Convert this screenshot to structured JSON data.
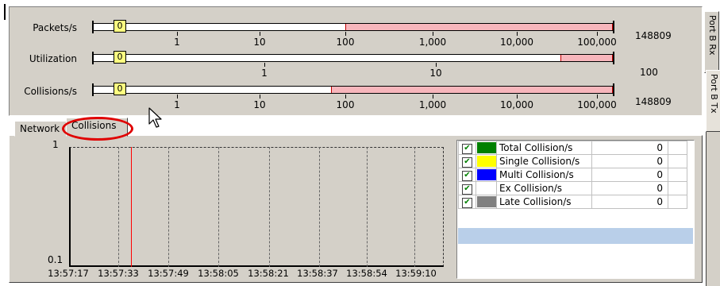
{
  "gauges": [
    {
      "label": "Packets/s",
      "value": "0",
      "total": "148809",
      "ticks": [
        "1",
        "10",
        "100",
        "1,000",
        "10,000",
        "100,000"
      ]
    },
    {
      "label": "Utilization",
      "value": "0",
      "total": "100",
      "ticks": [
        "1",
        "10"
      ]
    },
    {
      "label": "Collisions/s",
      "value": "0",
      "total": "148809",
      "ticks": [
        "1",
        "10",
        "100",
        "1,000",
        "10,000",
        "100,000"
      ]
    }
  ],
  "side_tabs": {
    "rx": "Port B Rx",
    "tx": "Port B Tx"
  },
  "tabs": {
    "network": "Network",
    "collisions": "Collisions",
    "active": "Collisions"
  },
  "graph": {
    "y_max": "1",
    "y_min": "0.1",
    "x_labels": [
      "13:57:17",
      "13:57:33",
      "13:57:49",
      "13:58:05",
      "13:58:21",
      "13:58:37",
      "13:58:54",
      "13:59:10"
    ],
    "cursor_color": "#ff0000"
  },
  "legend": {
    "rows": [
      {
        "checked": true,
        "color": "#008000",
        "name": "Total Collision/s",
        "value": "0"
      },
      {
        "checked": true,
        "color": "#ffff00",
        "name": "Single Collision/s",
        "value": "0"
      },
      {
        "checked": true,
        "color": "#0000ff",
        "name": "Multi Collision/s",
        "value": "0"
      },
      {
        "checked": true,
        "color": "#ffffff",
        "name": "Ex Collision/s",
        "value": "0"
      },
      {
        "checked": true,
        "color": "#808080",
        "name": "Late Collision/s",
        "value": "0"
      }
    ],
    "selected_row_color": "#b9cfe9"
  },
  "colors": {
    "panel": "#d4d0c8",
    "highlight_ellipse": "#e00000",
    "gauge_fill": "#f7b6bc"
  }
}
